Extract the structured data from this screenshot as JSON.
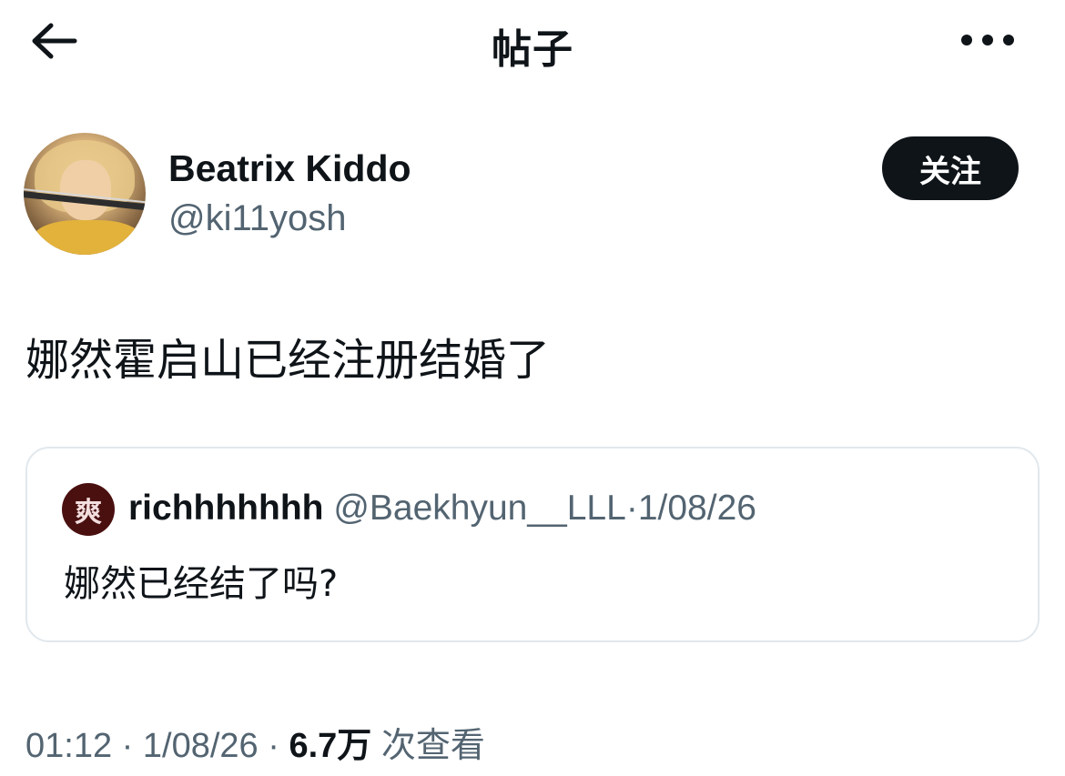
{
  "header": {
    "title": "帖子",
    "back_icon": "arrow-left-icon",
    "more_icon": "more-horizontal-icon"
  },
  "author": {
    "name": "Beatrix Kiddo",
    "handle": "@ki11yosh",
    "follow_label": "关注"
  },
  "post": {
    "text": "娜然霍启山已经注册结婚了"
  },
  "quote": {
    "avatar_glyph": "爽",
    "name": "richhhhhhh",
    "handle": "@Baekhyun__LLL",
    "separator": "·",
    "date": "1/08/26",
    "text": "娜然已经结了吗?"
  },
  "meta": {
    "time": "01:12",
    "separator": "·",
    "date": "1/08/26",
    "views_count": "6.7万",
    "views_label": "次查看"
  },
  "colors": {
    "text": "#0f1419",
    "secondary": "#536471",
    "border": "#e1e8ed",
    "button_bg": "#0f1419"
  }
}
